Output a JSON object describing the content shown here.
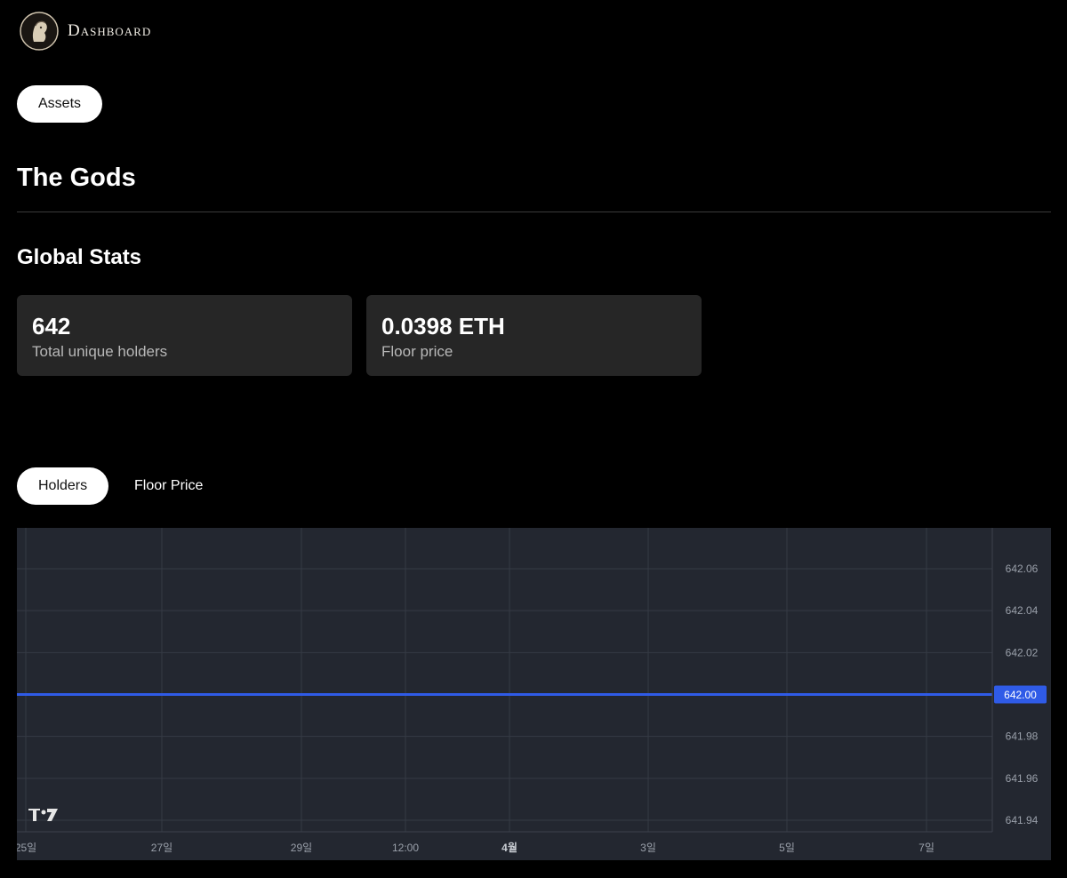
{
  "header": {
    "brand": "Dashboard",
    "logo_icon": "gods-bust-logo-icon"
  },
  "nav": {
    "assets_label": "Assets"
  },
  "page": {
    "title": "The Gods"
  },
  "global_stats": {
    "title": "Global Stats",
    "cards": [
      {
        "value": "642",
        "label": "Total unique holders"
      },
      {
        "value": "0.0398 ETH",
        "label": "Floor price"
      }
    ]
  },
  "chart_tabs": [
    {
      "label": "Holders",
      "active": true
    },
    {
      "label": "Floor Price",
      "active": false
    }
  ],
  "chart_data": {
    "type": "line",
    "series": [
      {
        "values": [
          642.0,
          642.0,
          642.0,
          642.0,
          642.0,
          642.0,
          642.0,
          642.0,
          642.0
        ]
      }
    ],
    "x_tick_labels": [
      "25일",
      "27일",
      "29일",
      "12:00",
      "4월",
      "3일",
      "5일",
      "7일"
    ],
    "y_tick_labels": [
      "642.06",
      "642.04",
      "642.02",
      "642.00",
      "641.98",
      "641.96",
      "641.94"
    ],
    "y_ticks": [
      642.06,
      642.04,
      642.02,
      642.0,
      641.98,
      641.96,
      641.94
    ],
    "ylim": [
      641.9345,
      642.0795
    ],
    "last_value_label": "642.00",
    "grid": true,
    "line_color": "#2f5be7",
    "background_color": "#232730",
    "watermark_icon": "tradingview-logo-icon"
  }
}
